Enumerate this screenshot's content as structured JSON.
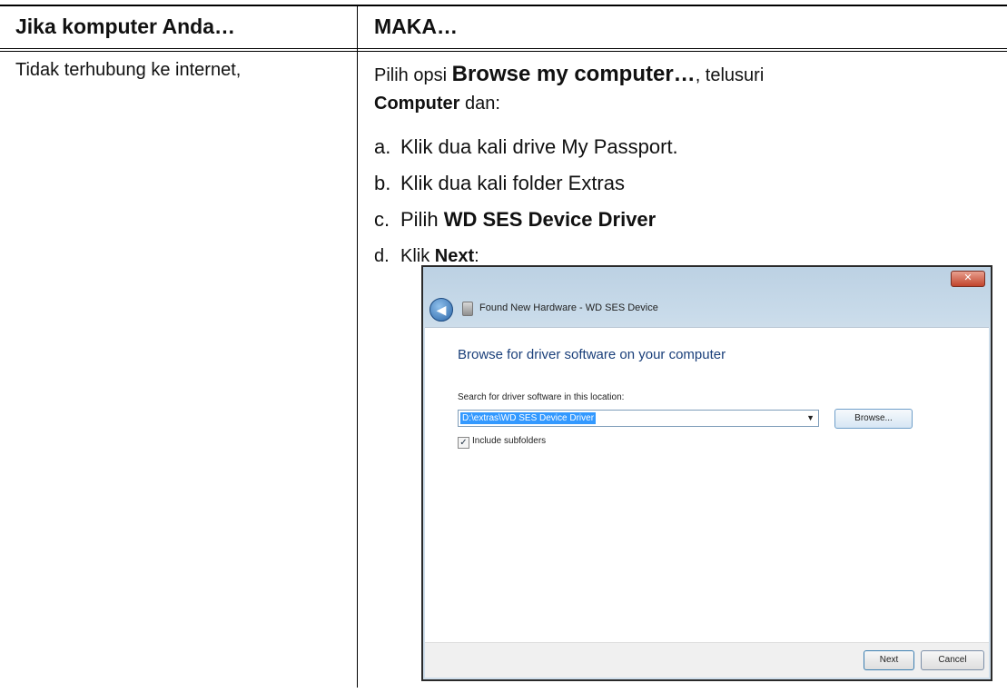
{
  "table": {
    "header_col1": "Jika komputer Anda…",
    "header_col2": "MAKA…",
    "row1_condition": "Tidak terhubung ke internet,"
  },
  "instructions": {
    "intro_pre": "Pilih opsi ",
    "intro_bold": "Browse my computer…",
    "intro_mid": ", telusuri",
    "intro_bold2": "Computer",
    "intro_post": " dan:",
    "steps": [
      {
        "marker": "a.",
        "text": "Klik dua kali drive My Passport."
      },
      {
        "marker": "b.",
        "text": "Klik dua kali folder Extras"
      },
      {
        "marker": "c.",
        "pre": "Pilih ",
        "bold": "WD SES Device Driver"
      },
      {
        "marker": "d.",
        "pre": "Klik ",
        "bold": "Next",
        "post": ":"
      }
    ]
  },
  "dialog": {
    "close_glyph": "✕",
    "back_glyph": "◀",
    "title": "Found New Hardware - WD SES Device",
    "heading": "Browse for driver software on your computer",
    "search_label": "Search for driver software in this location:",
    "path_value": "D:\\extras\\WD SES Device Driver",
    "dropdown_glyph": "▼",
    "browse_label": "Browse...",
    "include_subfolders_checked": true,
    "check_glyph": "✓",
    "include_subfolders_label": "Include subfolders",
    "next_label": "Next",
    "cancel_label": "Cancel"
  }
}
